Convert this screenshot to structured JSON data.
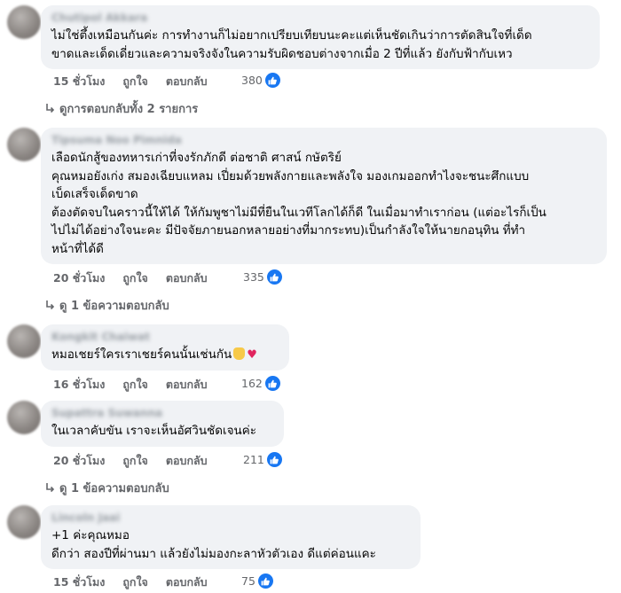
{
  "labels": {
    "like": "ถูกใจ",
    "reply": "ตอบกลับ"
  },
  "comments": [
    {
      "author": "Chutipol Akkara",
      "text": "ไม่ใช่ตึ้งเหมือนกันค่ะ การทำงานก็ไม่อยากเปรียบเทียบนะคะแต่เห็นชัดเกินว่าการตัดสินใจที่เด็ด\nขาดและเด็ดเดี่ยวและความจริงจังในความรับผิดชอบต่างจากเมื่อ 2 ปีที่แล้ว ยังกับฟ้ากับเหว",
      "time": "15 ชั่วโมง",
      "reactions": "380"
    },
    {
      "author": "Tipsuma Noo Pimnida",
      "text": "เลือดนักสู้ของทหารเก่าที่จงรักภักดี ต่อชาติ ศาสน์ กษัตริย์\nคุณหมอยังเก่ง สมองเฉียบแหลม เปี่ยมด้วยพลังกายและพลังใจ มองเกมออกทำไงจะชนะศึกแบบ\nเบ็ดเสร็จเด็ดขาด\nต้องตัดจบในคราวนี้ให้ได้ ให้กัมพูชาไม่มีที่ยืนในเวทีโลกได้ก็ดี ในเมื่อมาทำเราก่อน (แต่อะไรก็เป็น\nไปไม่ได้อย่างใจนะคะ มีปัจจัยภายนอกหลายอย่างที่มากระทบ)เป็นกำลังใจให้นายกอนุทิน ที่ทำ\nหน้าที่ได้ดี",
      "time": "20 ชั่วโมง",
      "reactions": "335"
    },
    {
      "author": "Kongkit Chaiwat",
      "text": "หมอเชยร์ใครเราเชยร์คนนั้นเช่นกัน",
      "time": "16 ชั่วโมง",
      "reactions": "162"
    },
    {
      "author": "Supattra Suwanna",
      "text": "ในเวลาคับขัน เราจะเห็นอัศวินชัดเจนค่ะ",
      "time": "20 ชั่วโมง",
      "reactions": "211"
    },
    {
      "author": "Lincoln Jaai",
      "text": "+1 ค่ะคุณหมอ\nดีกว่า สองปีที่ผ่านมา แล้วยังไม่มองกะลาหัวตัวเอง ดีแต่ค่อนแคะ",
      "time": "15 ชั่วโมง",
      "reactions": "75"
    }
  ],
  "view_replies": [
    "ดูการตอบกลับทั้ง 2 รายการ",
    "ดู 1 ข้อความตอบกลับ",
    "ดู 1 ข้อความตอบกลับ"
  ],
  "icons": {
    "reaction": "like-icon",
    "reply_arrow": "reply-arrow-icon",
    "emoji": [
      "thumbs-up-emoji",
      "heart-emoji"
    ]
  },
  "colors": {
    "bubble": "#f0f2f5",
    "meta_text": "#65676b",
    "like_blue": "#1877f2"
  }
}
